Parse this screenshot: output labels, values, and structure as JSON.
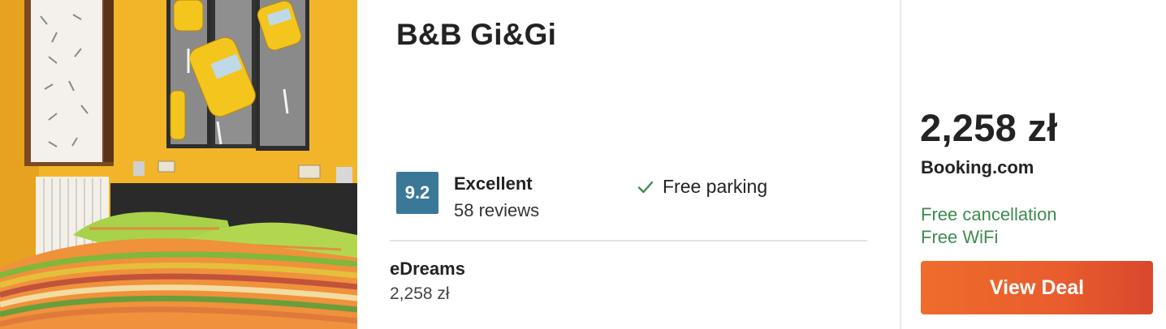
{
  "hotel": {
    "name": "B&B Gi&Gi",
    "rating": {
      "score": "9.2",
      "label": "Excellent",
      "reviews": "58 reviews"
    },
    "amenity": {
      "icon": "check-icon",
      "label": "Free parking"
    },
    "photo": {
      "icon": "hotel-room-photo"
    }
  },
  "alternative_deal": {
    "provider": "eDreams",
    "price": "2,258 zł"
  },
  "main_deal": {
    "price": "2,258 zł",
    "provider": "Booking.com",
    "perks": [
      "Free cancellation",
      "Free WiFi"
    ],
    "button_label": "View Deal"
  },
  "colors": {
    "rating_badge": "#3a7898",
    "perk_text": "#3d8b4f",
    "button": "#e85d2d"
  }
}
